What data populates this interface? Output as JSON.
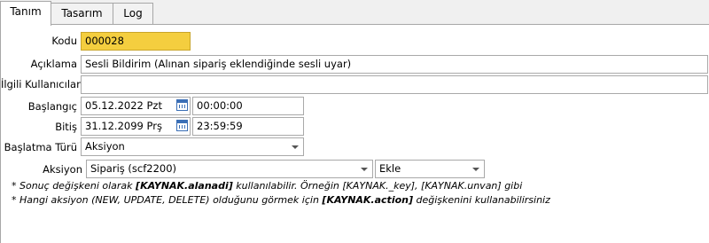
{
  "tabs": [
    {
      "label": "Tanım"
    },
    {
      "label": "Tasarım"
    },
    {
      "label": "Log"
    }
  ],
  "form": {
    "kodu": {
      "label": "Kodu",
      "value": "000028"
    },
    "aciklama": {
      "label": "Açıklama",
      "value": "Sesli Bildirim (Alınan sipariş eklendiğinde sesli uyar)"
    },
    "ilgili": {
      "label": "İlgili Kullanıcılar",
      "value": ""
    },
    "baslangic": {
      "label": "Başlangıç",
      "date": "05.12.2022 Pzt",
      "time": "00:00:00"
    },
    "bitis": {
      "label": "Bitiş",
      "date": "31.12.2099 Prş",
      "time": "23:59:59"
    },
    "baslatma": {
      "label": "Başlatma Türü",
      "value": "Aksiyon"
    },
    "aksiyon": {
      "label": "Aksiyon",
      "value": "Sipariş (scf2200)",
      "op": "Ekle"
    }
  },
  "notes": {
    "n1_pre": "* Sonuç değişkeni olarak ",
    "n1_key": "[KAYNAK.alanadi]",
    "n1_post": " kullanılabilir. Örneğin [KAYNAK._key], [KAYNAK.unvan] gibi",
    "n2_pre": "* Hangi aksiyon (NEW, UPDATE, DELETE) olduğunu görmek için ",
    "n2_key": "[KAYNAK.action]",
    "n2_post": " değişkenini kullanabilirsiniz"
  },
  "icons": {
    "calendar": "calendar-icon",
    "dropdown": "chevron-down-icon"
  }
}
